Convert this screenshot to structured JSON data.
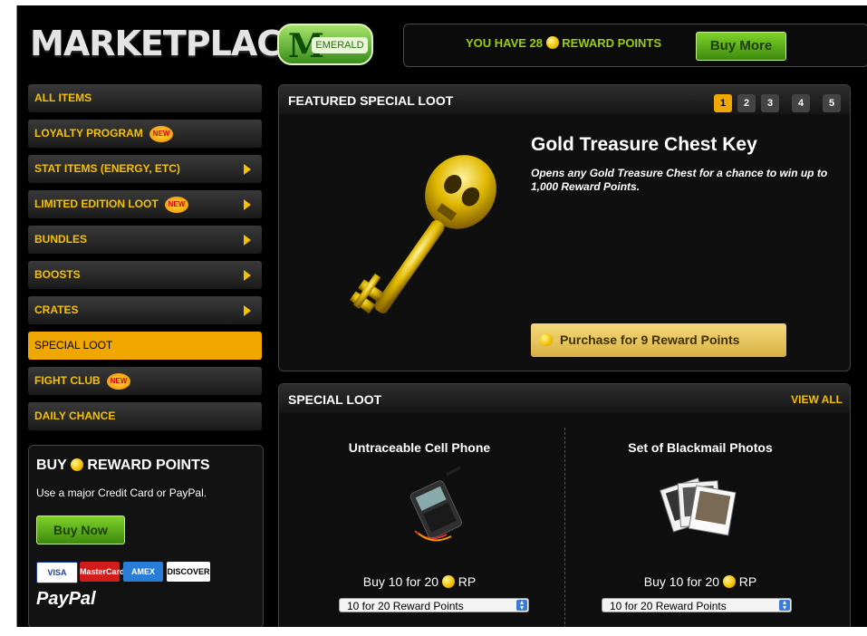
{
  "header": {
    "title": "MARKETPLACE",
    "badge_letter": "M",
    "badge_label": "EMERALD"
  },
  "reward_points": {
    "prefix": "YOU HAVE 28",
    "suffix": "REWARD POINTS",
    "buy_more_label": "Buy More"
  },
  "sidebar": {
    "items": [
      {
        "label": "ALL ITEMS"
      },
      {
        "label": "LOYALTY PROGRAM",
        "badge": "NEW"
      },
      {
        "label": "STAT ITEMS (ENERGY, ETC)"
      },
      {
        "label": "LIMITED EDITION LOOT",
        "badge": "NEW"
      },
      {
        "label": "BUNDLES"
      },
      {
        "label": "BOOSTS"
      },
      {
        "label": "CRATES"
      },
      {
        "label": "SPECIAL LOOT"
      },
      {
        "label": "FIGHT CLUB",
        "badge": "NEW"
      },
      {
        "label": "DAILY CHANCE"
      }
    ]
  },
  "buy_rp": {
    "title_prefix": "BUY",
    "title_suffix": "REWARD POINTS",
    "subtitle": "Use a major Credit Card or PayPal.",
    "button_label": "Buy Now",
    "cards": [
      "VISA",
      "MasterCard",
      "AMEX",
      "DISCOVER"
    ],
    "paypal": "PayPal"
  },
  "featured": {
    "title": "FEATURED SPECIAL LOOT",
    "pages": [
      "1",
      "2",
      "3",
      "4",
      "5"
    ],
    "item_name": "Gold Treasure Chest Key",
    "item_desc": "Opens any Gold Treasure Chest for a chance to win up to 1,000 Reward Points.",
    "purchase_label": "Purchase for 9 Reward Points"
  },
  "special_loot": {
    "title": "SPECIAL LOOT",
    "view_all": "VIEW ALL",
    "items": [
      {
        "name": "Untraceable Cell Phone",
        "price_prefix": "Buy 10 for 20",
        "price_suffix": "RP",
        "select_value": "10 for 20 Reward Points"
      },
      {
        "name": "Set of Blackmail Photos",
        "price_prefix": "Buy 10 for 20",
        "price_suffix": "RP",
        "select_value": "10 for 20 Reward Points"
      }
    ]
  },
  "colors": {
    "accent": "#f0a800",
    "green": "#7fd12a",
    "text_yellow": "#f5c000"
  }
}
